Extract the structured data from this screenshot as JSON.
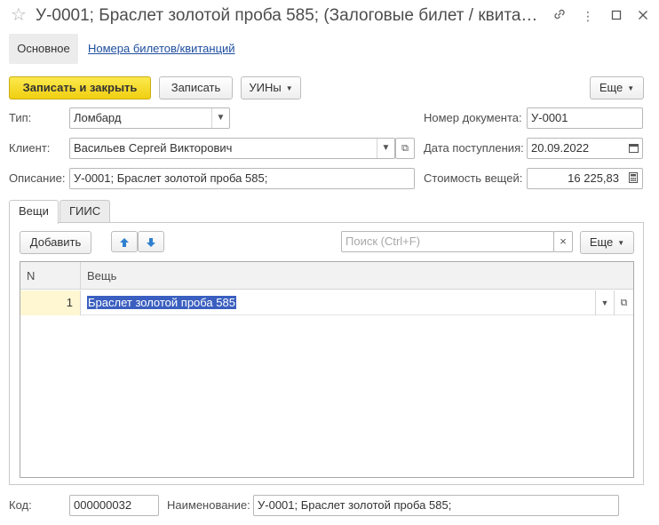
{
  "window": {
    "title": "У-0001; Браслет золотой проба 585; (Залоговые билет / квита…",
    "icons": [
      "star-icon",
      "link-icon",
      "more-vertical-icon",
      "maximize-icon",
      "close-icon"
    ]
  },
  "nav": {
    "main": "Основное",
    "tickets_link": "Номера билетов/квитанций"
  },
  "toolbar": {
    "save_close": "Записать и закрыть",
    "save": "Записать",
    "uins": "УИНы",
    "more": "Еще"
  },
  "form": {
    "type_label": "Тип:",
    "type_value": "Ломбард",
    "client_label": "Клиент:",
    "client_value": "Васильев Сергей Викторович",
    "desc_label": "Описание:",
    "desc_value": "У-0001; Браслет золотой проба 585;",
    "docnum_label": "Номер документа:",
    "docnum_value": "У-0001",
    "date_label": "Дата поступления:",
    "date_value": "20.09.2022",
    "cost_label": "Стоимость вещей:",
    "cost_value": "16 225,83"
  },
  "tabs": {
    "items": "Вещи",
    "giis": "ГИИС"
  },
  "items_toolbar": {
    "add": "Добавить",
    "search_placeholder": "Поиск (Ctrl+F)",
    "clear": "×",
    "more": "Еще"
  },
  "table": {
    "columns": [
      "N",
      "Вещь"
    ],
    "rows": [
      {
        "n": "1",
        "item": "Браслет золотой проба 585"
      }
    ]
  },
  "footer": {
    "code_label": "Код:",
    "code_value": "000000032",
    "name_label": "Наименование:",
    "name_value": "У-0001; Браслет золотой проба 585;"
  },
  "colors": {
    "primary_button": "#f4d21f",
    "link": "#1f4ea0",
    "selection": "#3b5fc0",
    "row_number_bg": "#fff7d2"
  }
}
